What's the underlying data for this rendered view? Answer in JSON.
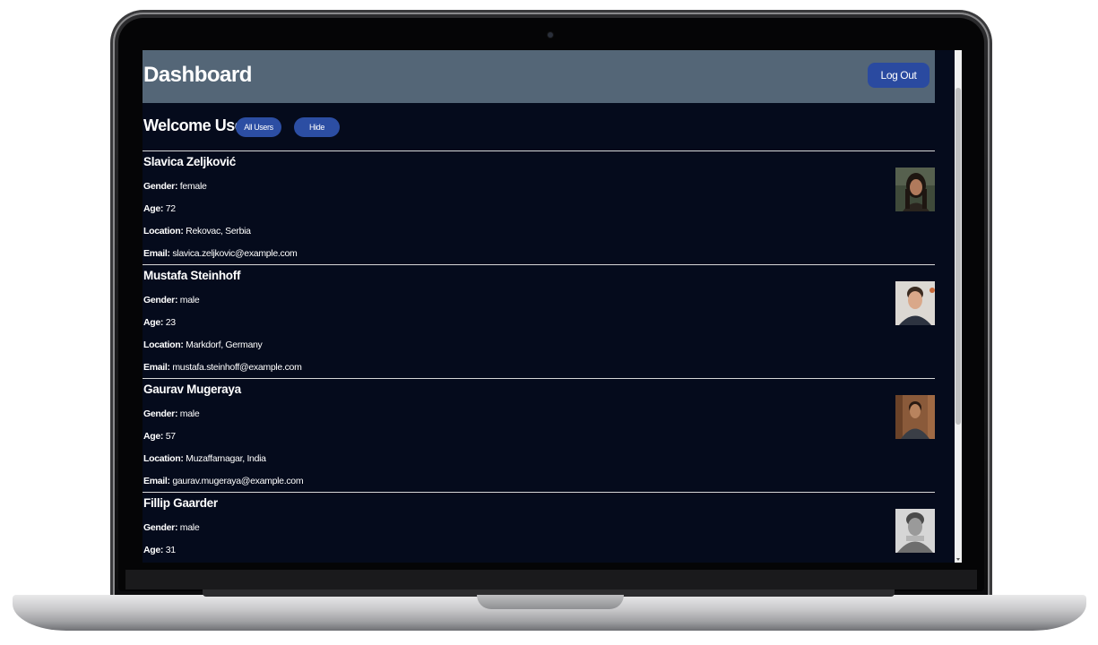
{
  "header": {
    "title": "Dashboard",
    "logout_label": "Log Out"
  },
  "toolbar": {
    "welcome": "Welcome User",
    "all_users_label": "All Users",
    "hide_label": "Hide"
  },
  "labels": {
    "gender": "Gender:",
    "age": "Age:",
    "location": "Location:",
    "email": "Email:"
  },
  "users": [
    {
      "name": "Slavica Zeljković",
      "gender": "female",
      "age": "72",
      "location": "Rekovac, Serbia",
      "email": "slavica.zeljkovic@example.com"
    },
    {
      "name": "Mustafa Steinhoff",
      "gender": "male",
      "age": "23",
      "location": "Markdorf, Germany",
      "email": "mustafa.steinhoff@example.com"
    },
    {
      "name": "Gaurav Mugeraya",
      "gender": "male",
      "age": "57",
      "location": "Muzaffarnagar, India",
      "email": "gaurav.mugeraya@example.com"
    },
    {
      "name": "Fillip Gaarder",
      "gender": "male",
      "age": "31"
    }
  ],
  "colors": {
    "header_bg": "#546677",
    "page_bg": "#050b1c",
    "button": "#2a4aa0"
  }
}
